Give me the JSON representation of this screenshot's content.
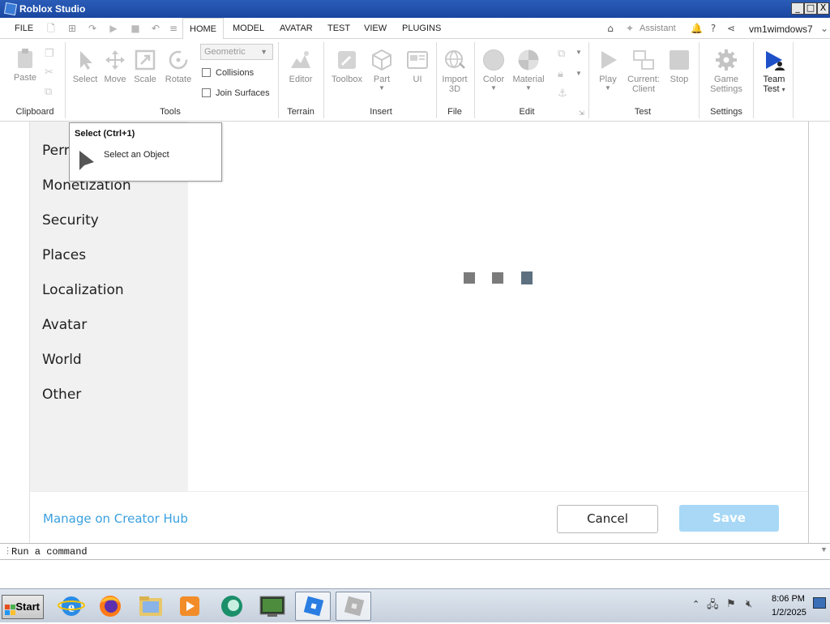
{
  "window": {
    "title": "Roblox Studio",
    "buttons": {
      "minimize": "_",
      "maximize": "□",
      "close": "X"
    }
  },
  "menu_tabs": [
    {
      "label": "FILE"
    },
    {
      "label": "HOME",
      "active": true
    },
    {
      "label": "MODEL"
    },
    {
      "label": "AVATAR"
    },
    {
      "label": "TEST"
    },
    {
      "label": "VIEW"
    },
    {
      "label": "PLUGINS"
    }
  ],
  "header_right": {
    "assistant_label": "Assistant",
    "username": "vm1wimdows7"
  },
  "ribbon": {
    "clipboard": {
      "paste": "Paste",
      "group": "Clipboard"
    },
    "tools": {
      "select": "Select",
      "move": "Move",
      "scale": "Scale",
      "rotate": "Rotate",
      "dropdown_value": "Geometric",
      "collisions": "Collisions",
      "join_surfaces": "Join Surfaces",
      "group": "Tools"
    },
    "terrain": {
      "editor": "Editor",
      "group": "Terrain"
    },
    "insert": {
      "toolbox": "Toolbox",
      "part": "Part",
      "ui": "UI",
      "group": "Insert"
    },
    "file": {
      "import_line1": "Import",
      "import_line2": "3D",
      "group": "File"
    },
    "edit": {
      "color": "Color",
      "material": "Material",
      "group": "Edit"
    },
    "test": {
      "play": "Play",
      "current_line1": "Current:",
      "current_line2": "Client",
      "stop": "Stop",
      "group": "Test"
    },
    "settings": {
      "game_line1": "Game",
      "game_line2": "Settings",
      "group": "Settings"
    },
    "team": {
      "line1": "Team",
      "line2": "Test"
    }
  },
  "tooltip": {
    "title": "Select (Ctrl+1)",
    "description": "Select an Object"
  },
  "settings_nav": [
    "Permissions",
    "Monetization",
    "Security",
    "Places",
    "Localization",
    "Avatar",
    "World",
    "Other"
  ],
  "footer": {
    "manage_link": "Manage on Creator Hub",
    "cancel": "Cancel",
    "save": "Save"
  },
  "command_bar": {
    "placeholder": "Run a command"
  },
  "taskbar": {
    "start": "Start",
    "time": "8:06 PM",
    "date": "1/2/2025"
  },
  "colors": {
    "titlebar": "#1a46a0",
    "link": "#3aa0e0",
    "save_disabled": "#a8d8f6",
    "loader_gray": "#7b7b7b",
    "loader_blue_gray": "#5d7080"
  }
}
